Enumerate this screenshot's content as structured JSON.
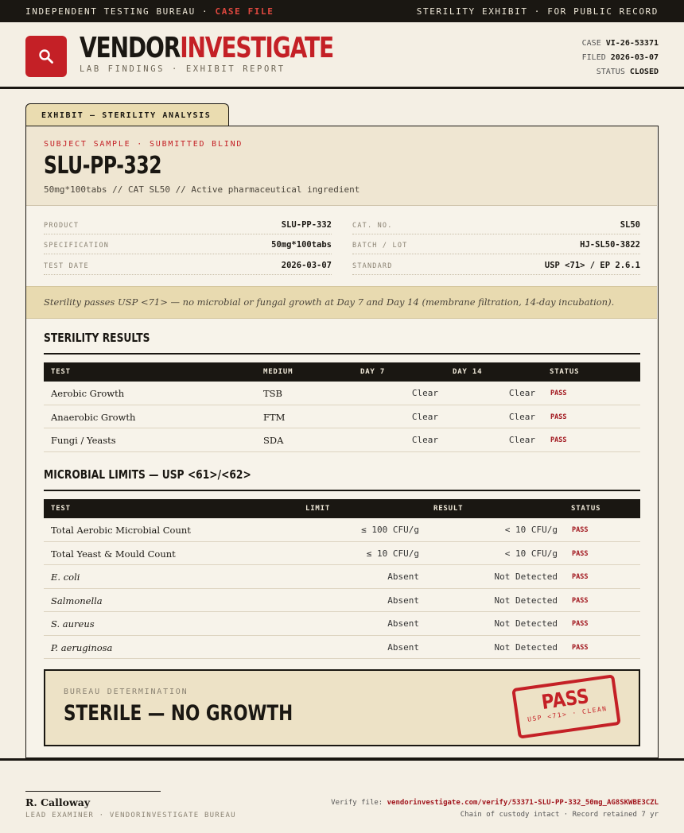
{
  "topbar": {
    "left": "INDEPENDENT TESTING BUREAU",
    "separator": " · ",
    "left_accent": "CASE FILE",
    "right": "STERILITY EXHIBIT · FOR PUBLIC RECORD"
  },
  "header": {
    "logo_icon": "magnifier-icon",
    "brand_part1": "VENDOR",
    "brand_part2": "INVESTIGATE",
    "tagline": "LAB FINDINGS · EXHIBIT REPORT",
    "case_label": "CASE",
    "case_value": "VI-26-53371",
    "filed_label": "FILED",
    "filed_value": "2026-03-07",
    "status_label": "STATUS",
    "status_value": "CLOSED"
  },
  "exhibit_tab": "EXHIBIT — STERILITY ANALYSIS",
  "subject": {
    "label": "SUBJECT SAMPLE · SUBMITTED BLIND",
    "title": "SLU-PP-332",
    "description": "50mg*100tabs  //  CAT SL50  //  Active pharmaceutical ingredient"
  },
  "spec": {
    "left": [
      {
        "key": "PRODUCT",
        "value": "SLU-PP-332"
      },
      {
        "key": "SPECIFICATION",
        "value": "50mg*100tabs"
      },
      {
        "key": "TEST DATE",
        "value": "2026-03-07"
      }
    ],
    "right": [
      {
        "key": "CAT. NO.",
        "value": "SL50"
      },
      {
        "key": "BATCH / LOT",
        "value": "HJ-SL50-3822"
      },
      {
        "key": "STANDARD",
        "value": "USP <71> / EP 2.6.1"
      }
    ]
  },
  "note": "Sterility passes USP <71> — no microbial or fungal growth at Day 7 and Day 14 (membrane filtration, 14-day incubation).",
  "sterility": {
    "title": "STERILITY RESULTS",
    "headers": [
      "TEST",
      "MEDIUM",
      "DAY 7",
      "DAY 14",
      "STATUS"
    ],
    "rows": [
      {
        "test": "Aerobic Growth",
        "medium": "TSB",
        "day7": "Clear",
        "day14": "Clear",
        "status": "PASS"
      },
      {
        "test": "Anaerobic Growth",
        "medium": "FTM",
        "day7": "Clear",
        "day14": "Clear",
        "status": "PASS"
      },
      {
        "test": "Fungi / Yeasts",
        "medium": "SDA",
        "day7": "Clear",
        "day14": "Clear",
        "status": "PASS"
      }
    ]
  },
  "microbial": {
    "title": "MICROBIAL LIMITS — USP <61>/<62>",
    "headers": [
      "TEST",
      "LIMIT",
      "RESULT",
      "STATUS"
    ],
    "rows": [
      {
        "test": "Total Aerobic Microbial Count",
        "limit": "≤ 100 CFU/g",
        "result": "< 10 CFU/g",
        "status": "PASS"
      },
      {
        "test": "Total Yeast & Mould Count",
        "limit": "≤ 10 CFU/g",
        "result": "< 10 CFU/g",
        "status": "PASS"
      },
      {
        "test": "E. coli",
        "limit": "Absent",
        "result": "Not Detected",
        "status": "PASS"
      },
      {
        "test": "Salmonella",
        "limit": "Absent",
        "result": "Not Detected",
        "status": "PASS"
      },
      {
        "test": "S. aureus",
        "limit": "Absent",
        "result": "Not Detected",
        "status": "PASS"
      },
      {
        "test": "P. aeruginosa",
        "limit": "Absent",
        "result": "Not Detected",
        "status": "PASS"
      }
    ]
  },
  "determination": {
    "label": "BUREAU DETERMINATION",
    "title": "STERILE — NO GROWTH",
    "stamp_title": "PASS",
    "stamp_sub": "USP <71> · CLEAN"
  },
  "footer": {
    "signer": "R. Calloway",
    "role": "LEAD EXAMINER · VENDORINVESTIGATE BUREAU",
    "verify_label": "Verify file: ",
    "verify_link": "vendorinvestigate.com/verify/53371-SLU-PP-332_50mg_AG8SKWBE3CZL",
    "custody": "Chain of custody intact · Record retained 7 yr"
  },
  "colors": {
    "accent_red": "#c42026",
    "ink": "#1a1712",
    "paper": "#f4efe4",
    "highlight": "#e8dab0"
  }
}
